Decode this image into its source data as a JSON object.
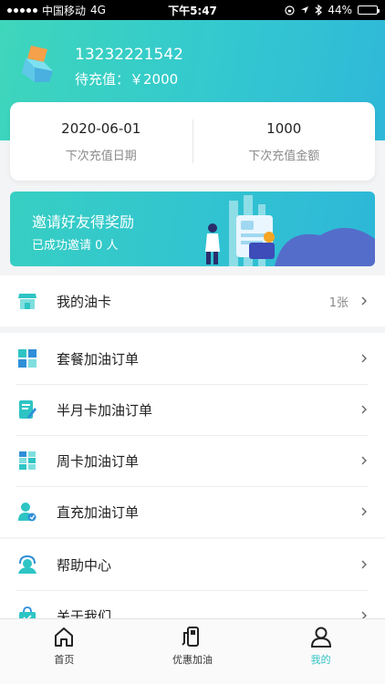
{
  "status_bar": {
    "carrier": "中国移动",
    "network": "4G",
    "time": "下午5:47",
    "battery": "44%",
    "battery_level": 0.44
  },
  "profile": {
    "phone": "13232221542",
    "pending_label": "待充值：",
    "pending_amount": "￥2000"
  },
  "summary": {
    "next_date_value": "2020-06-01",
    "next_date_label": "下次充值日期",
    "next_amount_value": "1000",
    "next_amount_label": "下次充值金额"
  },
  "banner": {
    "title": "邀请好友得奖励",
    "subtitle": "已成功邀请 0 人"
  },
  "menu": {
    "oil_card": {
      "label": "我的油卡",
      "extra": "1张"
    },
    "package_orders": {
      "label": "套餐加油订单"
    },
    "half_month_orders": {
      "label": "半月卡加油订单"
    },
    "weekly_orders": {
      "label": "周卡加油订单"
    },
    "direct_orders": {
      "label": "直充加油订单"
    },
    "help_center": {
      "label": "帮助中心"
    },
    "about_us": {
      "label": "关于我们"
    }
  },
  "tabbar": {
    "home": "首页",
    "discount": "优惠加油",
    "mine": "我的"
  },
  "colors": {
    "accent": "#33c3c6",
    "icon_teal": "#2ec4c4",
    "icon_blue": "#2f8fd8"
  }
}
